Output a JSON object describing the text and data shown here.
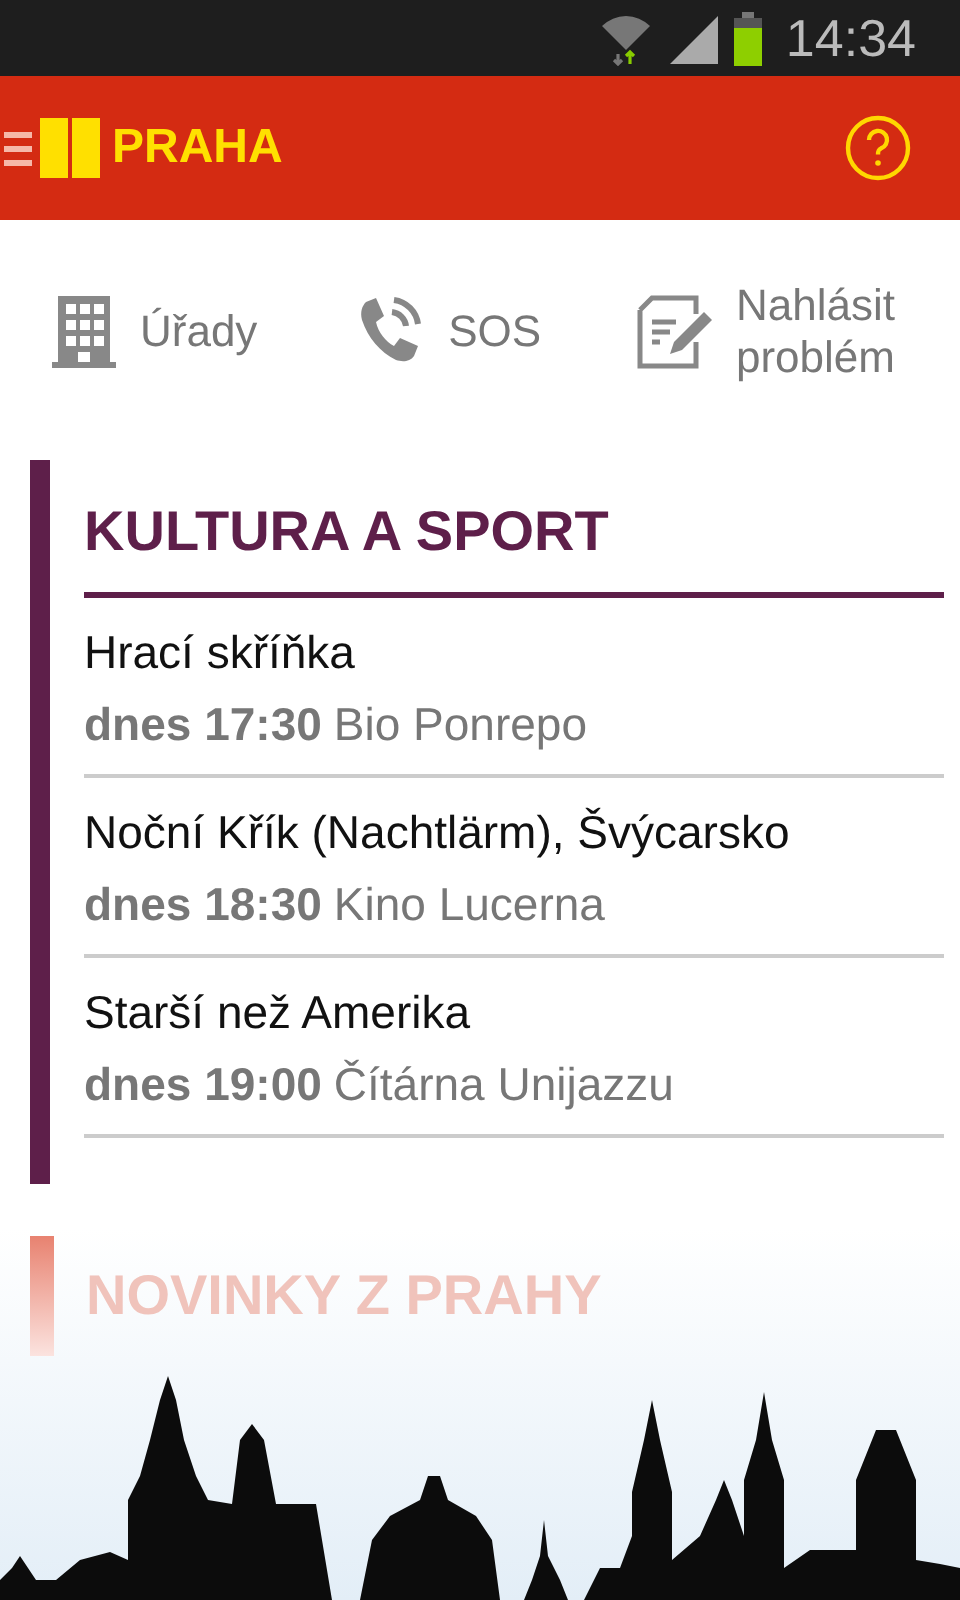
{
  "status_bar": {
    "time": "14:34"
  },
  "app_bar": {
    "title": "PRAHA"
  },
  "quick_actions": [
    {
      "kind": "building",
      "label": "Úřady"
    },
    {
      "kind": "phone",
      "label": "SOS"
    },
    {
      "kind": "report",
      "label": "Nahlásit problém"
    }
  ],
  "culture_section": {
    "title": "KULTURA A SPORT",
    "events": [
      {
        "title": "Hrací skříňka",
        "time": "dnes 17:30",
        "place": "Bio Ponrepo"
      },
      {
        "title": "Noční Křík (Nachtlärm), Švýcarsko",
        "time": "dnes 18:30",
        "place": "Kino Lucerna"
      },
      {
        "title": "Starší než Amerika",
        "time": "dnes 19:00",
        "place": "Čítárna Unijazzu"
      }
    ]
  },
  "news_section": {
    "title": "NOVINKY Z PRAHY"
  }
}
